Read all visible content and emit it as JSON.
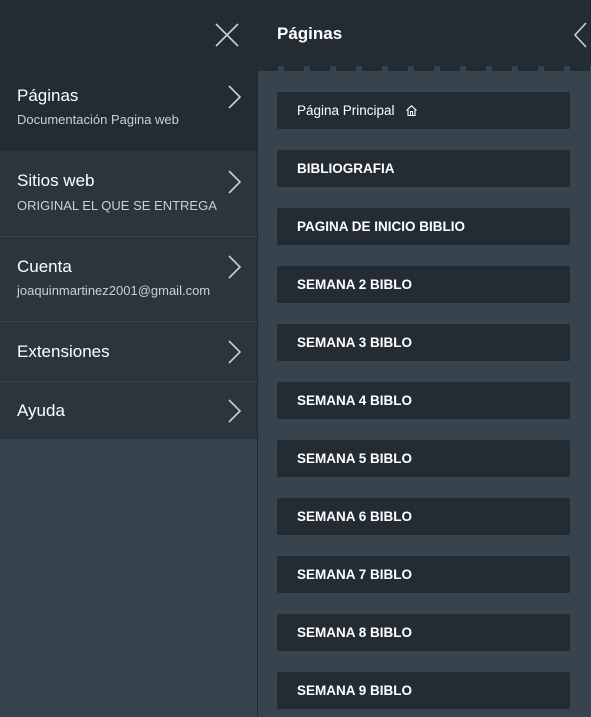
{
  "left_menu": {
    "items": [
      {
        "title": "Páginas",
        "subtitle": "Documentación Pagina web"
      },
      {
        "title": "Sitios web",
        "subtitle": "ORIGINAL EL QUE SE ENTREGA"
      },
      {
        "title": "Cuenta",
        "subtitle": "joaquinmartinez2001@gmail.com"
      },
      {
        "title": "Extensiones"
      },
      {
        "title": "Ayuda"
      }
    ]
  },
  "right_panel": {
    "title": "Páginas",
    "pages": [
      {
        "label": "Página Principal",
        "icon": "home-icon"
      },
      {
        "label": "BIBLIOGRAFIA"
      },
      {
        "label": "PAGINA DE INICIO BIBLIO"
      },
      {
        "label": "SEMANA 2 BIBLO"
      },
      {
        "label": "SEMANA 3 BIBLO"
      },
      {
        "label": "SEMANA 4 BIBLO"
      },
      {
        "label": "SEMANA 5 BIBLO"
      },
      {
        "label": "SEMANA 6 BIBLO"
      },
      {
        "label": "SEMANA 7 BIBLO"
      },
      {
        "label": "SEMANA 8 BIBLO"
      },
      {
        "label": "SEMANA 9 BIBLO"
      }
    ]
  },
  "colors": {
    "panel_dark": "#232b33",
    "panel_mid": "#2b353e",
    "background": "#37444e",
    "text": "#ffffff"
  }
}
